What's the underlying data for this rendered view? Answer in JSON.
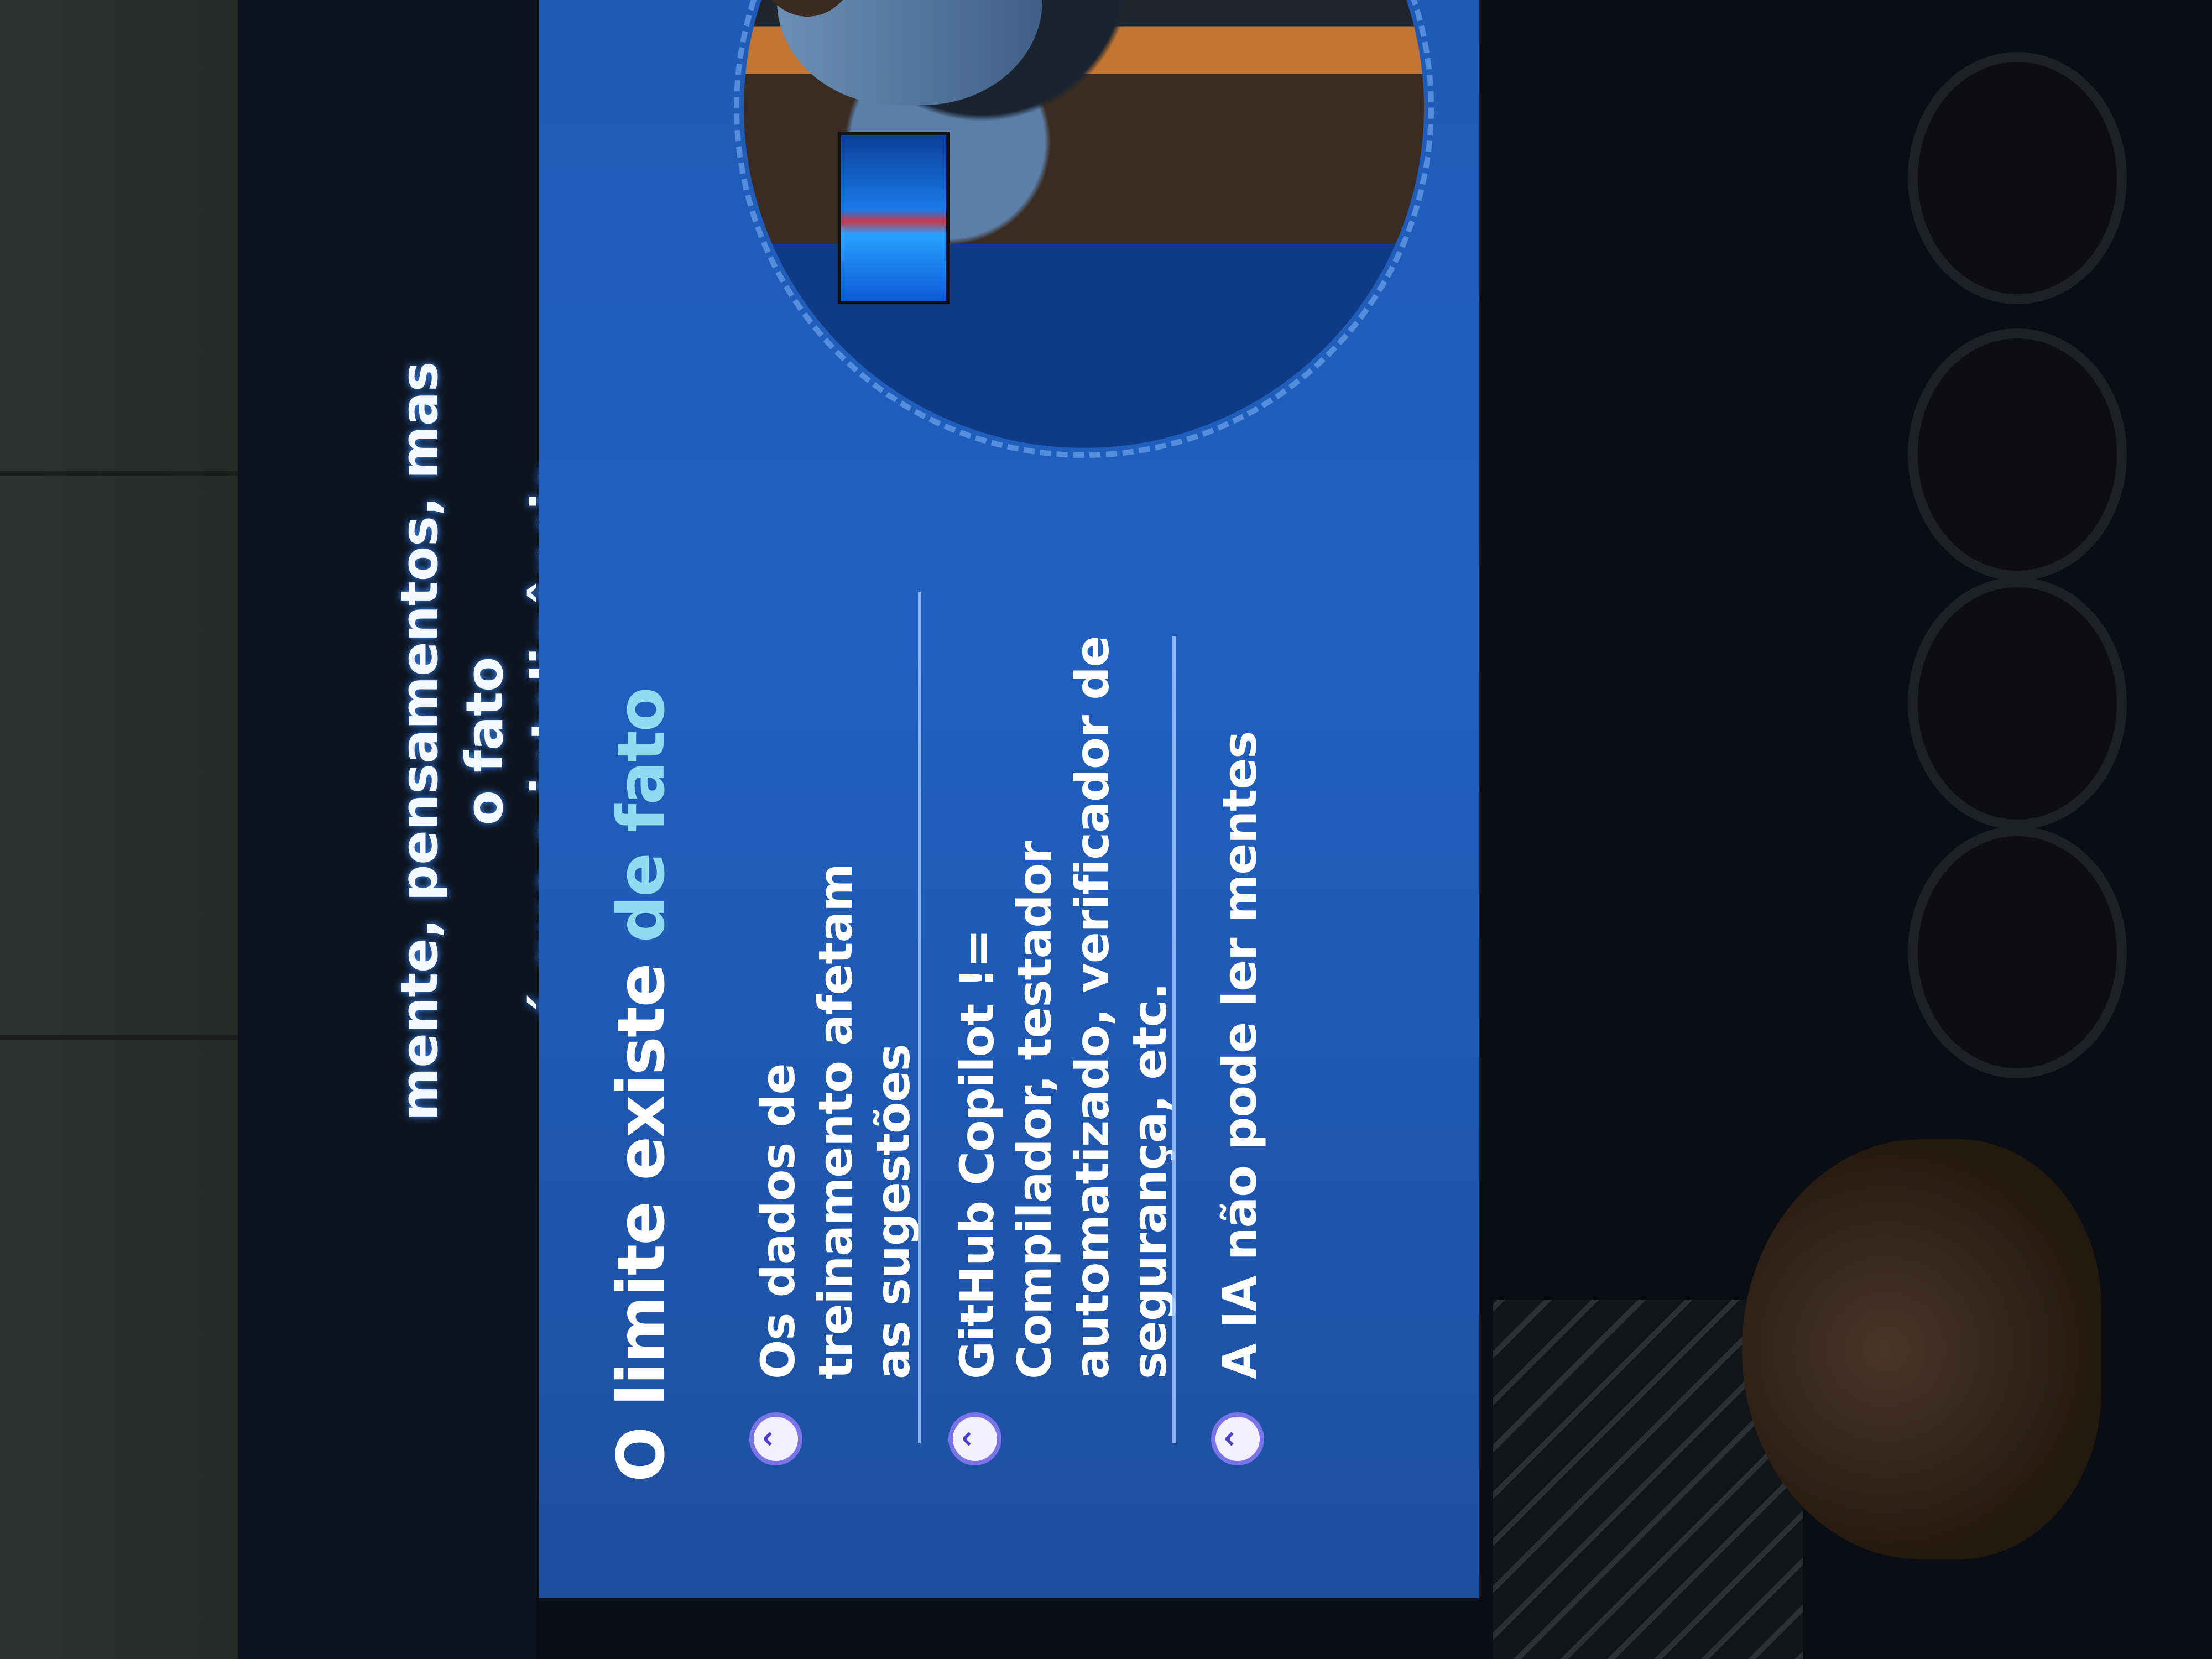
{
  "caption": {
    "line1": "mente, pensamentos, mas o fato",
    "line2": "é que a inteligência"
  },
  "slide": {
    "title_main": "O limite existe ",
    "title_accent": "de fato",
    "items": [
      {
        "icon": "chevron-up-icon",
        "text": "Os dados de treinamento afetam as sugestões"
      },
      {
        "icon": "chevron-up-icon",
        "text": "GitHub Copilot != Compilador, testador automatizado, verificador de segurança, etc."
      },
      {
        "icon": "chevron-up-icon",
        "text": "A IA não pode ler mentes"
      }
    ],
    "chevron_glyph": "⌃"
  },
  "colors": {
    "slide_blue": "#2160c0",
    "title_accent": "#8fdcf0",
    "chevron_border": "#7b74e8"
  }
}
